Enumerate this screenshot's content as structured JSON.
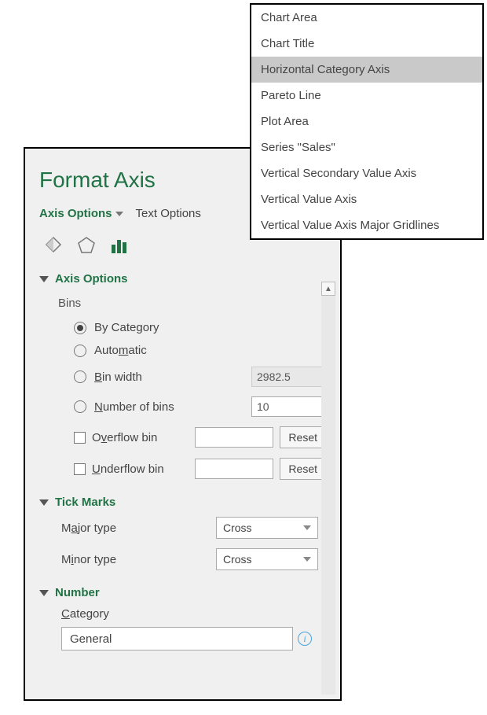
{
  "dropdown": {
    "items": [
      "Chart Area",
      "Chart Title",
      "Horizontal Category Axis",
      "Pareto Line",
      "Plot Area",
      "Series \"Sales\"",
      "Vertical Secondary Value Axis",
      "Vertical Value Axis",
      "Vertical Value Axis Major Gridlines"
    ],
    "selected_index": 2
  },
  "panel": {
    "title": "Format Axis",
    "tabs": {
      "axis_options": "Axis Options",
      "text_options": "Text Options"
    },
    "sections": {
      "axis_options": {
        "title": "Axis Options",
        "bins_label": "Bins",
        "by_category": "By Category",
        "automatic": "Automatic",
        "bin_width": "Bin width",
        "bin_width_value": "2982.5",
        "number_of_bins": "Number of bins",
        "number_of_bins_value": "10",
        "overflow_bin": "Overflow bin",
        "overflow_value": "",
        "underflow_bin": "Underflow bin",
        "underflow_value": "",
        "reset": "Reset"
      },
      "tick_marks": {
        "title": "Tick Marks",
        "major_type": "Major type",
        "major_value": "Cross",
        "minor_type": "Minor type",
        "minor_value": "Cross"
      },
      "number": {
        "title": "Number",
        "category_label": "Category",
        "category_value": "General"
      }
    }
  }
}
